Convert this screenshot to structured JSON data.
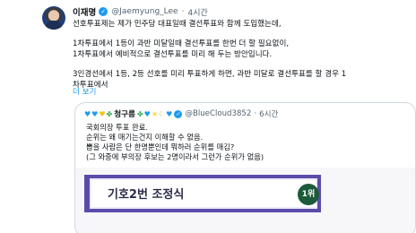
{
  "tweet": {
    "display_name": "이재명",
    "handle": "@Jaemyung_Lee",
    "separator": "·",
    "time": "4시간",
    "lines": [
      "선호투표제는 제가 민주당 대표일때 결선투표와 함께 도입했는데,",
      "1차투표에서 1등이 과반 미달일때 결선투표를 한번 더 할 필요없이,",
      "1차투표에서 예비적으로 결선투표를 미리 해 두는 방안입니다.",
      "3인경선에서 1등, 2등 선호를 미리 투표하게 하면, 과반 미달로 결선투표를 할 경우 1",
      "차투표에서"
    ],
    "more_label": "더 보기"
  },
  "quote": {
    "display_name": "청구름",
    "handle": "@BlueCloud3852",
    "separator": "·",
    "time": "6시간",
    "lines": [
      "국회의장 투표 완료.",
      "순위는 왜 매기는건지 이해할 수 없음.",
      "뽑을 사람은 단 한명뿐인데 뭐하러 순위를 매김?",
      "(그 와중에 부의장 후보는 2명이라서 그런가 순위가 없음)",
      "..."
    ],
    "ballot": {
      "candidate": "기호2번 조정식",
      "rank": "1위"
    }
  }
}
